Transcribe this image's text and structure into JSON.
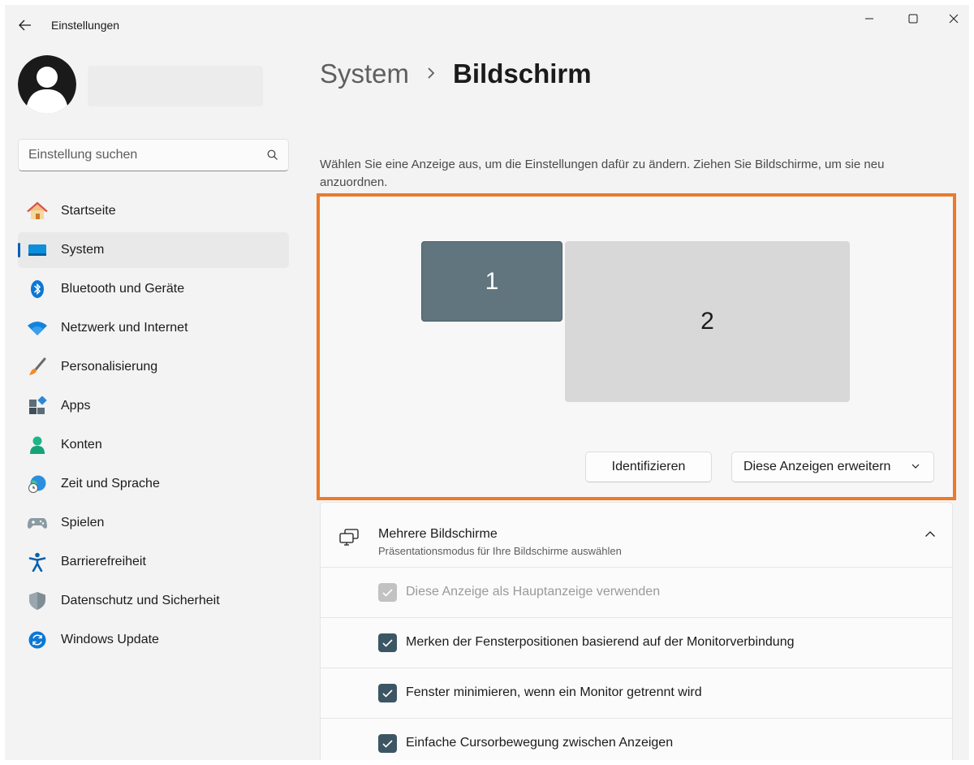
{
  "app": {
    "title": "Einstellungen"
  },
  "search": {
    "placeholder": "Einstellung suchen"
  },
  "sidebar": {
    "items": [
      {
        "label": "Startseite",
        "icon": "home-icon"
      },
      {
        "label": "System",
        "icon": "system-icon",
        "active": true
      },
      {
        "label": "Bluetooth und Geräte",
        "icon": "bluetooth-icon"
      },
      {
        "label": "Netzwerk und Internet",
        "icon": "wifi-icon"
      },
      {
        "label": "Personalisierung",
        "icon": "brush-icon"
      },
      {
        "label": "Apps",
        "icon": "apps-icon"
      },
      {
        "label": "Konten",
        "icon": "account-icon"
      },
      {
        "label": "Zeit und Sprache",
        "icon": "globe-clock-icon"
      },
      {
        "label": "Spielen",
        "icon": "gamepad-icon"
      },
      {
        "label": "Barrierefreiheit",
        "icon": "accessibility-icon"
      },
      {
        "label": "Datenschutz und Sicherheit",
        "icon": "shield-icon"
      },
      {
        "label": "Windows Update",
        "icon": "update-icon"
      }
    ]
  },
  "header": {
    "parent": "System",
    "current": "Bildschirm"
  },
  "display": {
    "intro": "Wählen Sie eine Anzeige aus, um die Einstellungen dafür zu ändern. Ziehen Sie Bildschirme, um sie neu anzuordnen.",
    "monitors": [
      {
        "label": "1",
        "selected": true
      },
      {
        "label": "2",
        "selected": false
      }
    ],
    "identify_label": "Identifizieren",
    "mode_label": "Diese Anzeigen erweitern"
  },
  "multi": {
    "title": "Mehrere Bildschirme",
    "subtitle": "Präsentationsmodus für Ihre Bildschirme auswählen",
    "options": [
      {
        "label": "Diese Anzeige als Hauptanzeige verwenden",
        "checked": true,
        "disabled": true
      },
      {
        "label": "Merken der Fensterpositionen basierend auf der Monitorverbindung",
        "checked": true,
        "disabled": false
      },
      {
        "label": "Fenster minimieren, wenn ein Monitor getrennt wird",
        "checked": true,
        "disabled": false
      },
      {
        "label": "Einfache Cursorbewegung zwischen Anzeigen",
        "checked": true,
        "disabled": false
      }
    ]
  },
  "colors": {
    "accent": "#005fb8",
    "highlight_border": "#ec7a2b",
    "checkbox": "#3d5663",
    "monitor_selected": "#61757f"
  }
}
